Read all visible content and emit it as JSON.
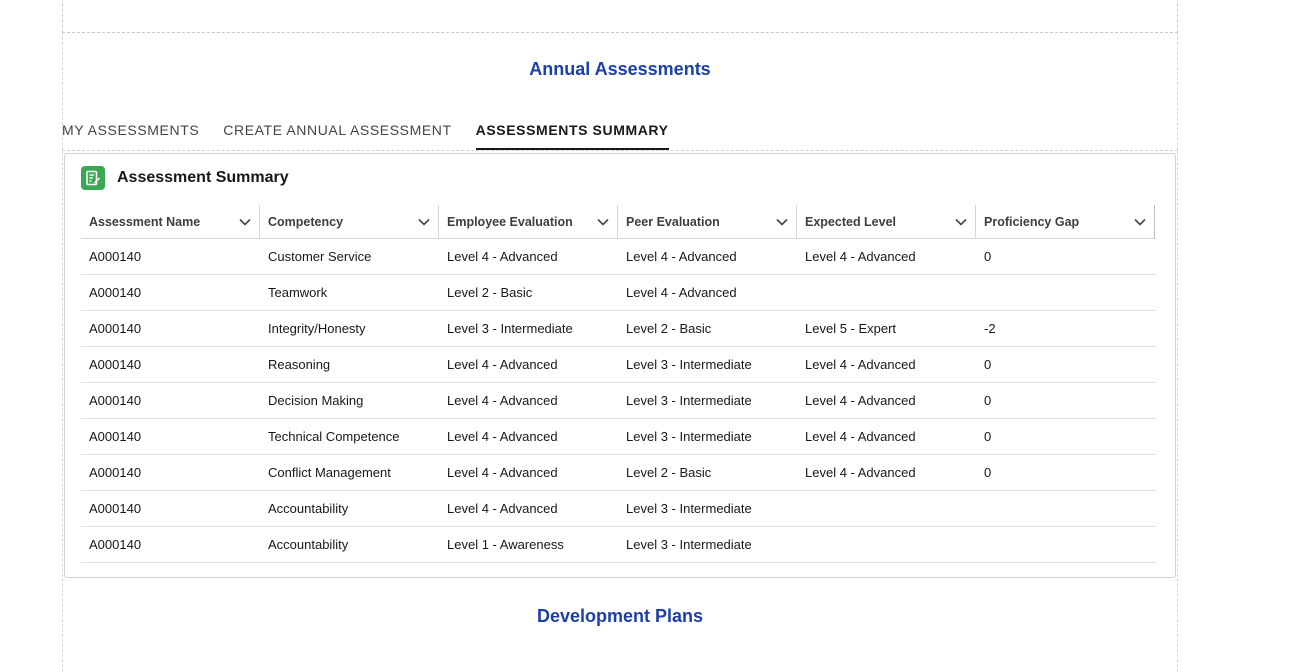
{
  "header": {
    "title": "Annual Assessments"
  },
  "tabs": [
    {
      "label": "MY ASSESSMENTS",
      "active": false
    },
    {
      "label": "CREATE ANNUAL ASSESSMENT",
      "active": false
    },
    {
      "label": "ASSESSMENTS SUMMARY",
      "active": true
    }
  ],
  "summary_card": {
    "title": "Assessment Summary",
    "icon": "assessment-summary-icon",
    "icon_color": "#3ba755",
    "columns": [
      "Assessment Name",
      "Competency",
      "Employee Evaluation",
      "Peer Evaluation",
      "Expected Level",
      "Proficiency Gap"
    ],
    "rows": [
      [
        "A000140",
        "Customer Service",
        "Level 4 - Advanced",
        "Level 4 - Advanced",
        "Level 4 - Advanced",
        "0"
      ],
      [
        "A000140",
        "Teamwork",
        "Level 2 - Basic",
        "Level 4 - Advanced",
        "",
        ""
      ],
      [
        "A000140",
        "Integrity/Honesty",
        "Level 3 - Intermediate",
        "Level 2 - Basic",
        "Level 5 - Expert",
        "-2"
      ],
      [
        "A000140",
        "Reasoning",
        "Level 4 - Advanced",
        "Level 3 - Intermediate",
        "Level 4 - Advanced",
        "0"
      ],
      [
        "A000140",
        "Decision Making",
        "Level 4 - Advanced",
        "Level 3 - Intermediate",
        "Level 4 - Advanced",
        "0"
      ],
      [
        "A000140",
        "Technical Competence",
        "Level 4 - Advanced",
        "Level 3 - Intermediate",
        "Level 4 - Advanced",
        "0"
      ],
      [
        "A000140",
        "Conflict Management",
        "Level 4 - Advanced",
        "Level 2 - Basic",
        "Level 4 - Advanced",
        "0"
      ],
      [
        "A000140",
        "Accountability",
        "Level 4 - Advanced",
        "Level 3 - Intermediate",
        "",
        ""
      ],
      [
        "A000140",
        "Accountability",
        "Level 1 - Awareness",
        "Level 3 - Intermediate",
        "",
        ""
      ]
    ]
  },
  "development": {
    "title": "Development Plans"
  },
  "colors": {
    "accent": "#1c3fa8",
    "icon_bg": "#3ba755"
  }
}
